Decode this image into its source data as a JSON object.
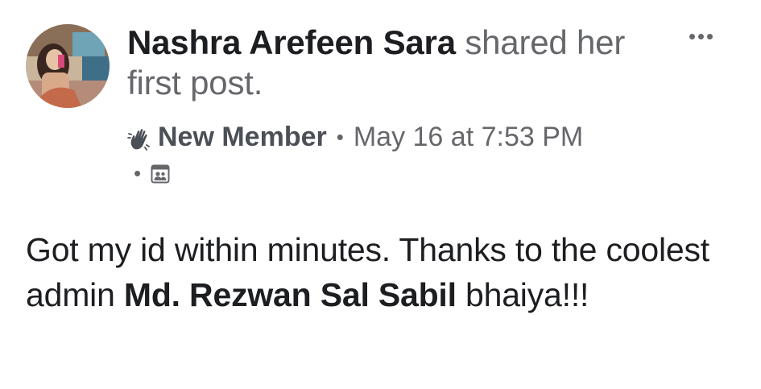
{
  "post": {
    "author": {
      "name": "Nashra Arefeen Sara",
      "action_text": " shared her first post."
    },
    "meta": {
      "badge_icon": "wave-icon",
      "badge_label": "New Member",
      "separator": "•",
      "timestamp": "May 16 at 7:53 PM",
      "privacy_icon": "group-icon"
    },
    "body": {
      "text_before": "Got my id within minutes. Thanks to the coolest admin ",
      "mention": "Md. Rezwan Sal Sabil",
      "text_after": " bhaiya!!!"
    },
    "menu_icon": "more-options-icon"
  },
  "colors": {
    "primary_text": "#1c1e21",
    "secondary_text": "#65676b",
    "background": "#ffffff"
  }
}
